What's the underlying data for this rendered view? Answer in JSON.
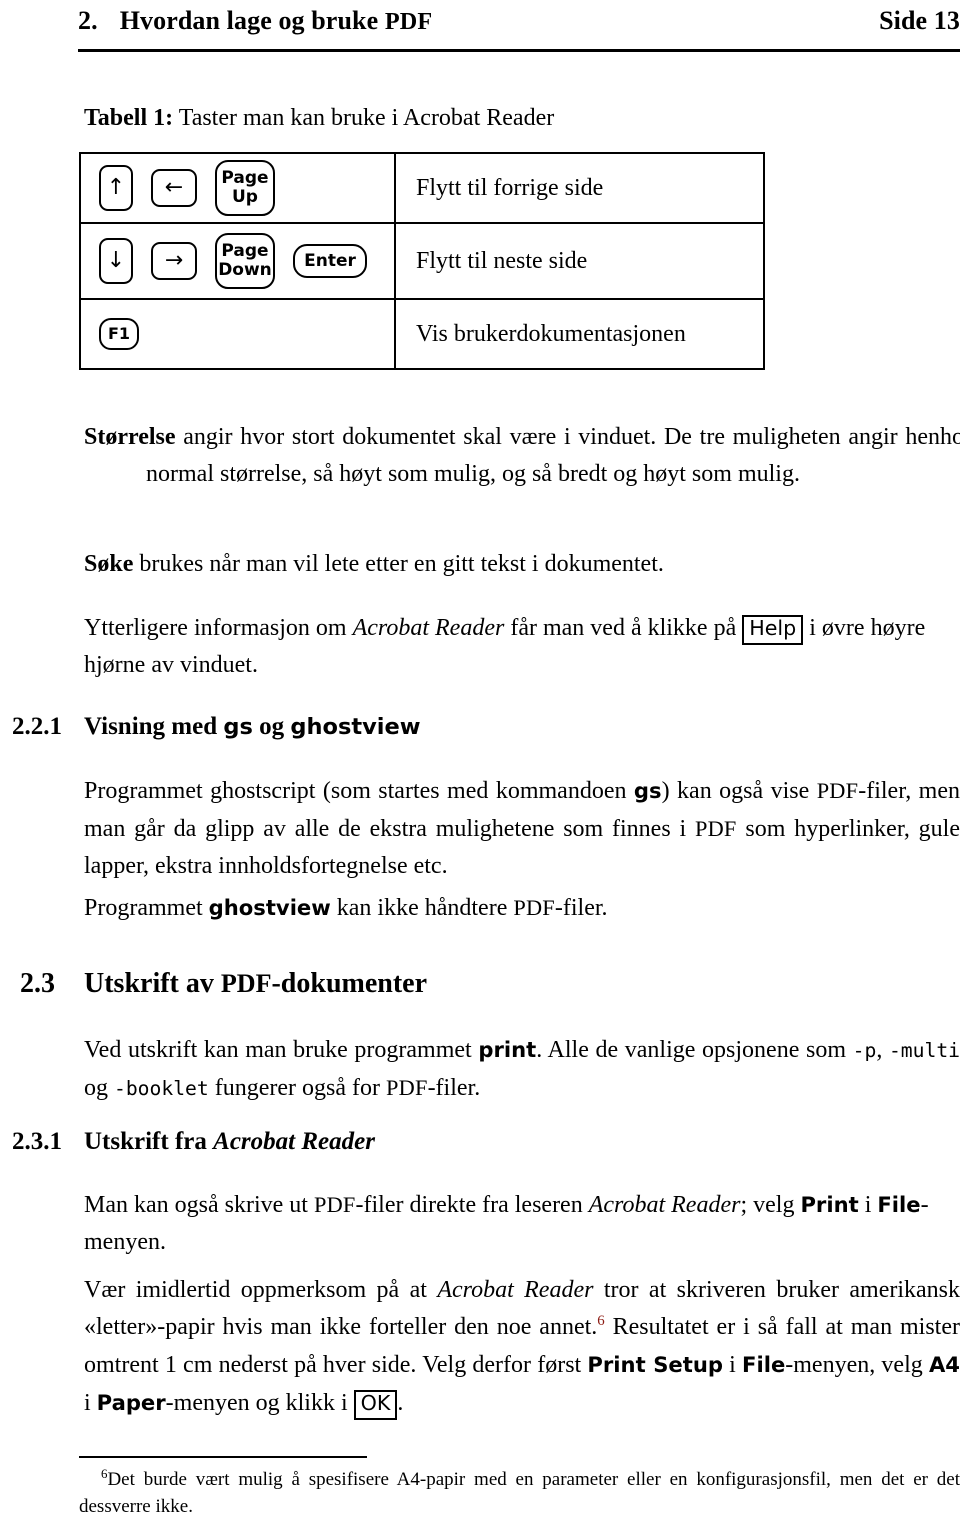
{
  "header": {
    "section_number": "2.",
    "title_prefix": "Hvordan lage og bruke ",
    "title_acronym": "PDF",
    "page_label": "Side 13"
  },
  "table": {
    "caption_label": "Tabell 1:",
    "caption_text": " Taster man kan bruke i Acrobat Reader",
    "rows": [
      {
        "keys": [
          {
            "type": "arrow",
            "glyph": "↑",
            "name": "arrow-up-key"
          },
          {
            "type": "arrow-wide",
            "glyph": "←",
            "name": "arrow-left-key"
          },
          {
            "type": "two-line",
            "line1": "Page",
            "line2": "Up",
            "name": "page-up-key"
          }
        ],
        "description": "Flytt til forrige side"
      },
      {
        "keys": [
          {
            "type": "arrow",
            "glyph": "↓",
            "name": "arrow-down-key"
          },
          {
            "type": "arrow-wide",
            "glyph": "→",
            "name": "arrow-right-key"
          },
          {
            "type": "two-line",
            "line1": "Page",
            "line2": "Down",
            "name": "page-down-key"
          },
          {
            "type": "enter",
            "glyph": "Enter",
            "name": "enter-key"
          }
        ],
        "description": "Flytt til neste side"
      },
      {
        "keys": [
          {
            "type": "f1",
            "glyph": "F1",
            "name": "f1-key"
          }
        ],
        "description": "Vis brukerdokumentasjonen"
      }
    ]
  },
  "body": {
    "p_storrelse": {
      "term": "Størrelse",
      "text": " angir hvor stort dokumentet skal være i vinduet. De tre muligheten angir henholdsvis normal størrelse, så høyt som mulig, og så bredt og høyt som mulig."
    },
    "p_soke": {
      "term": "Søke",
      "text": " brukes når man vil lete etter en gitt tekst i dokumentet."
    },
    "p_ytterligere": {
      "part1": "Ytterligere informasjon om ",
      "italic1": "Acrobat Reader",
      "part2": " får man ved å klikke på ",
      "button": "Help",
      "part3": " i øvre høyre hjørne av vinduet."
    }
  },
  "sections": {
    "s221": {
      "number": "2.2.1",
      "title_part1": "Visning med ",
      "title_mono1": "gs",
      "title_part2": " og ",
      "title_mono2": "ghostview"
    },
    "s23": {
      "number": "2.3",
      "title_part1": "Utskrift av ",
      "title_acronym": "PDF",
      "title_part2": "-dokumenter"
    },
    "s231": {
      "number": "2.3.1",
      "title_part1": "Utskrift fra ",
      "title_italic": "Acrobat Reader"
    }
  },
  "paragraphs": {
    "p_ghostscript": {
      "part1": "Programmet ghostscript (som startes med kommandoen ",
      "cmd": "gs",
      "part2": ") kan også vise ",
      "acr1": "PDF",
      "part3": "-filer, men man går da glipp av alle de ekstra mulighetene som finnes i ",
      "acr2": "PDF",
      "part4": " som hyperlinker, gule lapper, ekstra innholdsfortegnelse etc."
    },
    "p_ghostview": {
      "part1": "Programmet ",
      "cmd": "ghostview",
      "part2": " kan ikke håndtere ",
      "acr1": "PDF",
      "part3": "-filer."
    },
    "p_print": {
      "part1": "Ved utskrift kan man bruke programmet ",
      "cmd": "print",
      "part2": ". Alle de vanlige opsjonene som ",
      "opt1": "-p",
      "part3": ", ",
      "opt2": "-multi",
      "part4": " og ",
      "opt3": "-booklet",
      "part5": " fungerer også for ",
      "acr1": "PDF",
      "part6": "-filer."
    },
    "p_skrivut": {
      "part1": "Man kan også skrive ut ",
      "acr1": "PDF",
      "part2": "-filer direkte fra leseren ",
      "italic1": "Acrobat Reader",
      "part3": "; velg ",
      "menu1": "Print",
      "part4": " i ",
      "menu2": "File",
      "part5": "-menyen."
    },
    "p_letter": {
      "part1": "Vær imidlertid oppmerksom på at ",
      "italic1": "Acrobat Reader",
      "part2": " tror at skriveren bruker amerikansk «letter»-papir hvis man ikke forteller den noe annet.",
      "fnref": "6",
      "part3": " Resultatet er i så fall at man mister omtrent 1 cm nederst på hver side. Velg derfor først ",
      "menu1": "Print Setup",
      "part4": " i ",
      "menu2": "File",
      "part5": "-menyen, velg ",
      "menu3": "A4",
      "part6": " i ",
      "menu4": "Paper",
      "part7": "-menyen og klikk i ",
      "button": "OK",
      "part8": "."
    }
  },
  "footnote": {
    "marker": "6",
    "text": "Det burde vært mulig å spesifisere A4-papir med en parameter eller en konfigurasjonsfil, men det er det dessverre ikke."
  },
  "colors": {
    "text": "#000000",
    "footnote_ref": "#8c1a12",
    "rule": "#000000"
  }
}
